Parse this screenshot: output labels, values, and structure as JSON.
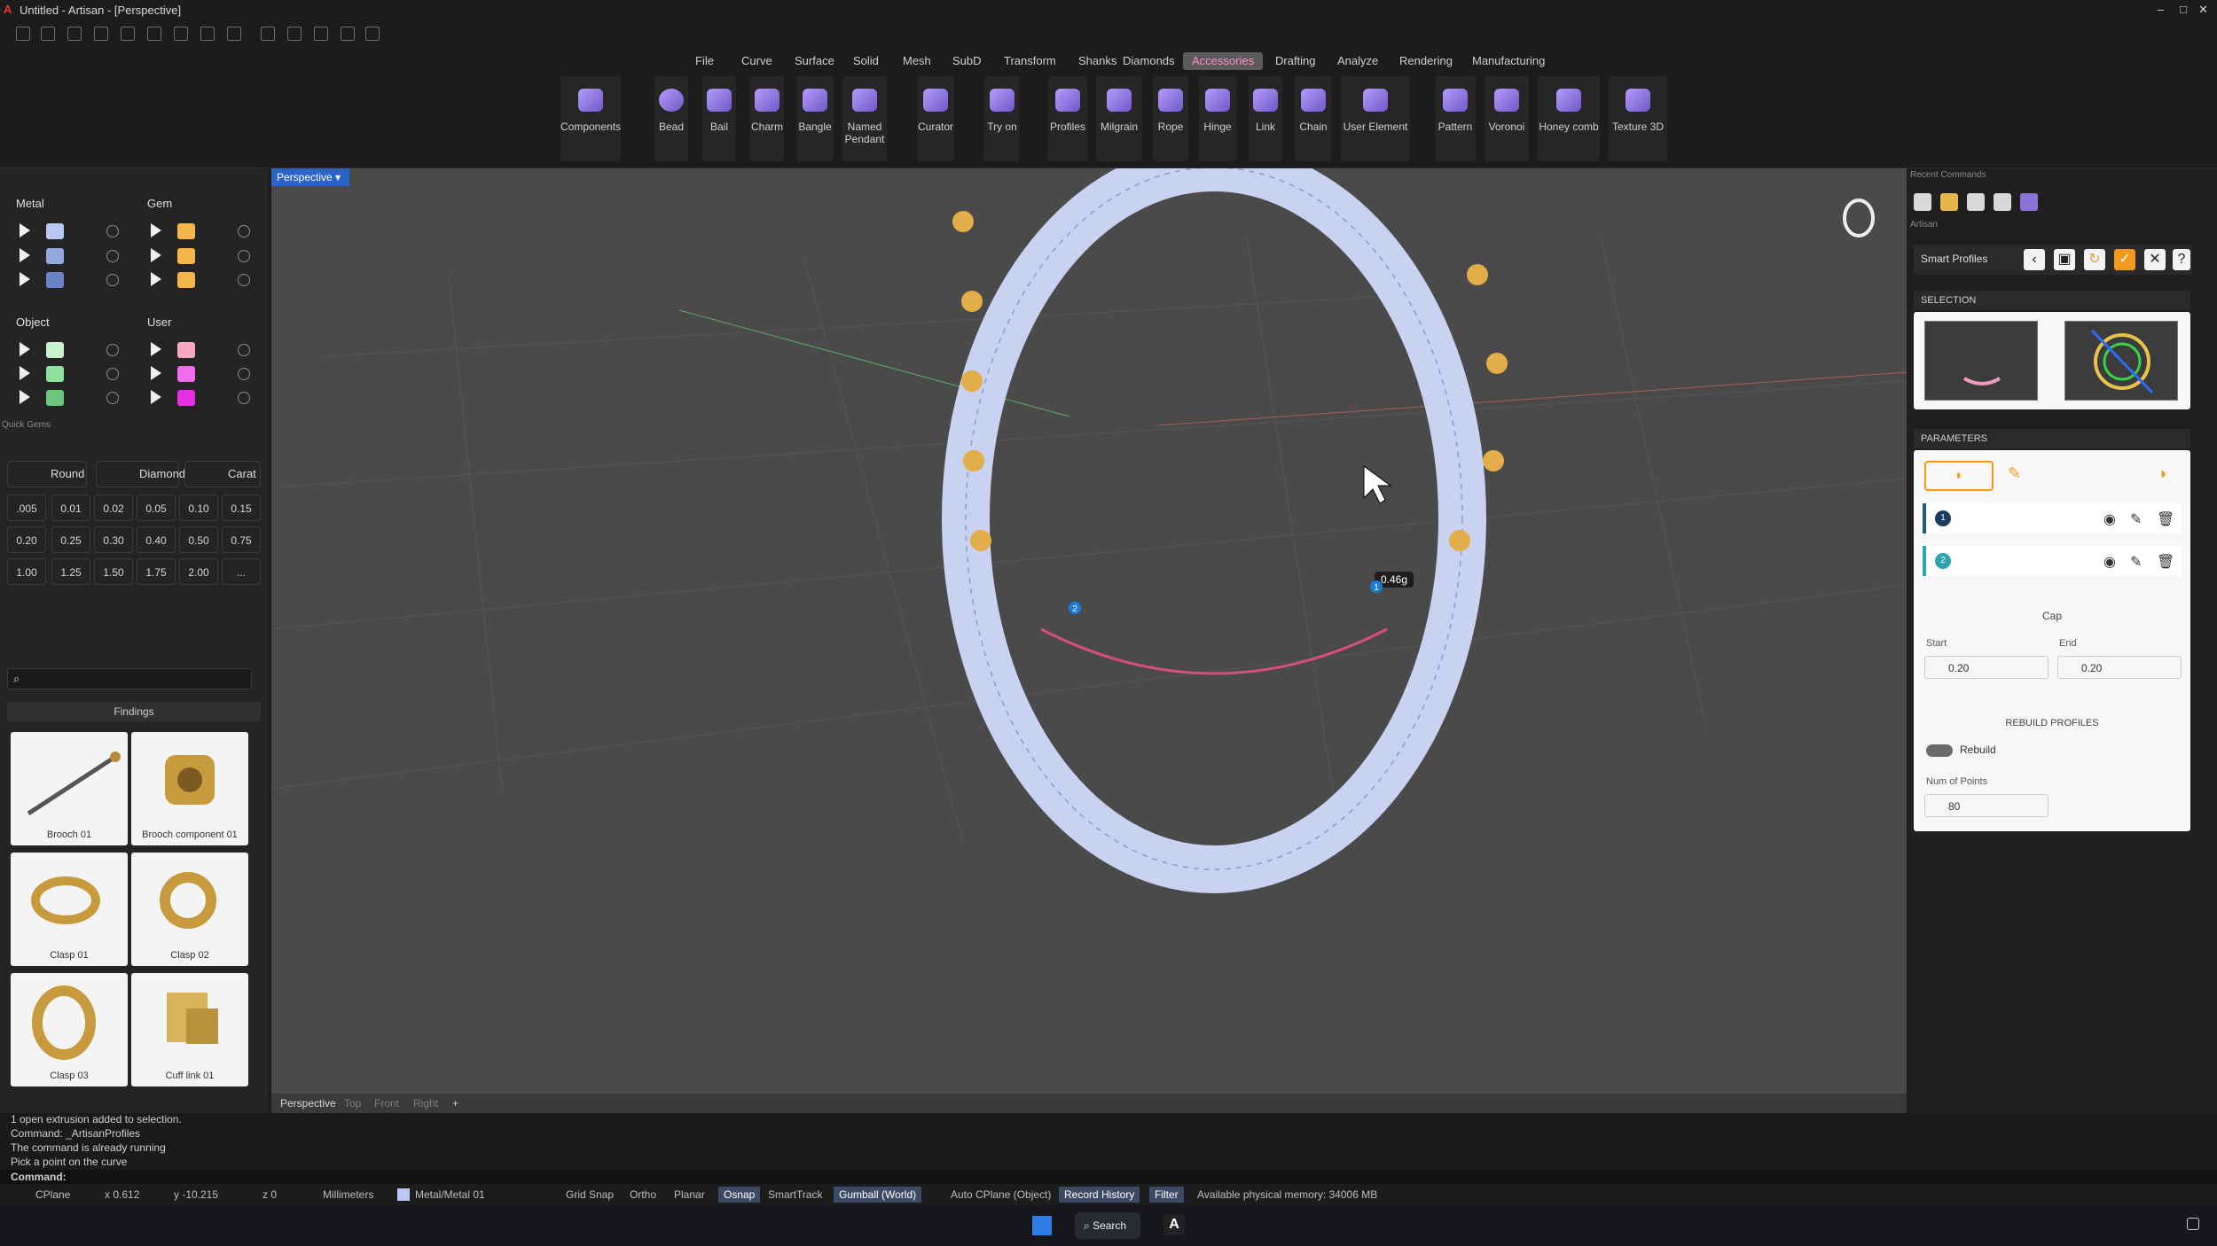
{
  "window": {
    "title": "Untitled - Artisan - [Perspective]"
  },
  "menu": [
    "File",
    "Curve",
    "Surface",
    "Solid",
    "Mesh",
    "SubD",
    "Transform",
    "Shanks",
    "Diamonds",
    "Accessories",
    "Drafting",
    "Analyze",
    "Rendering",
    "Manufacturing"
  ],
  "active_menu": "Accessories",
  "ribbon": [
    "Components",
    "Bead",
    "Bail",
    "Charm",
    "Bangle",
    "Named Pendant",
    "Curator",
    "Try on",
    "Profiles",
    "Milgrain",
    "Rope",
    "Hinge",
    "Link",
    "Chain",
    "User Element",
    "Pattern",
    "Voronoi",
    "Honey comb",
    "Texture 3D"
  ],
  "layers": {
    "metal": "Metal",
    "gem": "Gem",
    "object": "Object",
    "user": "User"
  },
  "quick_gems": {
    "title": "Quick Gems",
    "round": "Round",
    "diamond": "Diamond",
    "carat": "Carat",
    "sizes": [
      ".005",
      "0.01",
      "0.02",
      "0.05",
      "0.10",
      "0.15",
      "0.20",
      "0.25",
      "0.30",
      "0.40",
      "0.50",
      "0.75",
      "1.00",
      "1.25",
      "1.50",
      "1.75",
      "2.00",
      "..."
    ]
  },
  "findings": {
    "title": "Findings",
    "items": [
      "Brooch 01",
      "Brooch component 01",
      "Clasp 01",
      "Clasp 02",
      "Clasp 03",
      "Cuff link 01"
    ]
  },
  "viewport": {
    "label": "Perspective",
    "weight_label": "0.46g",
    "tabs": [
      "Perspective",
      "Top",
      "Front",
      "Right"
    ]
  },
  "right": {
    "recent": "Recent Commands",
    "artisan": "Artisan",
    "smart_profiles": "Smart Profiles",
    "selection": "SELECTION",
    "parameters": "PARAMETERS",
    "cap": "Cap",
    "start_label": "Start",
    "start_value": "0.20",
    "end_label": "End",
    "end_value": "0.20",
    "rebuild_profiles": "REBUILD PROFILES",
    "rebuild": "Rebuild",
    "num_points_label": "Num of Points",
    "num_points": "80",
    "p1": "1",
    "p2": "2"
  },
  "command_log": [
    "1 open extrusion added to selection.",
    "Command: _ArtisanProfiles",
    "The command is already running",
    "Pick a point on the curve"
  ],
  "command_prompt": "Command:",
  "status": {
    "cplane": "CPlane",
    "x": "x 0.612",
    "y": "y -10.215",
    "z": "z 0",
    "units": "Millimeters",
    "layer": "Metal/Metal 01",
    "grid_snap": "Grid Snap",
    "ortho": "Ortho",
    "planar": "Planar",
    "osnap": "Osnap",
    "smarttrack": "SmartTrack",
    "gumball": "Gumball (World)",
    "auto_cplane": "Auto CPlane (Object)",
    "record_history": "Record History",
    "filter": "Filter",
    "memory": "Available physical memory: 34006 MB"
  },
  "taskbar": {
    "search": "Search"
  }
}
